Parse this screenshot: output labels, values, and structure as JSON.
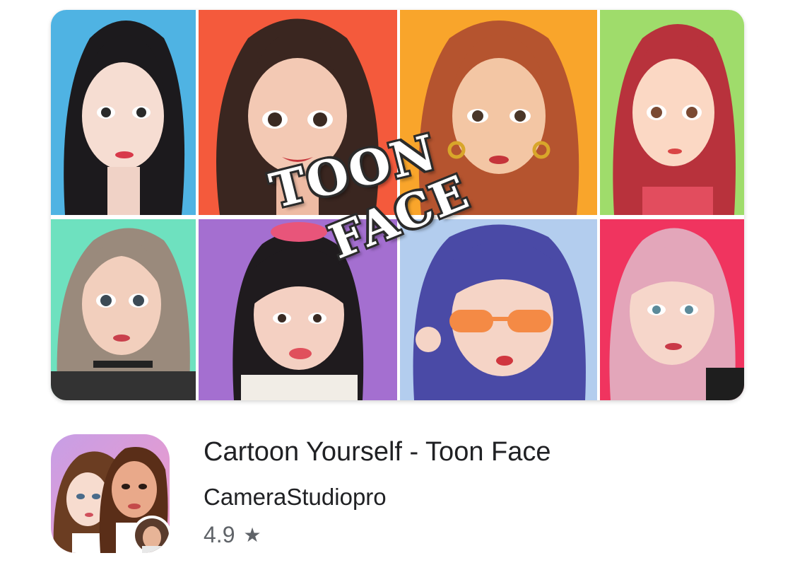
{
  "banner": {
    "logo_line1": "TOON",
    "logo_line2": "FACE",
    "tile_colors": [
      "#4fb3e3",
      "#f45a3c",
      "#f9a52b",
      "#9fdc6b",
      "#6ee1bf",
      "#a46fd0",
      "#b3cdee",
      "#f0345f"
    ]
  },
  "app": {
    "title": "Cartoon Yourself - Toon Face",
    "developer": "CameraStudiopro",
    "rating": "4.9",
    "star_glyph": "★"
  }
}
